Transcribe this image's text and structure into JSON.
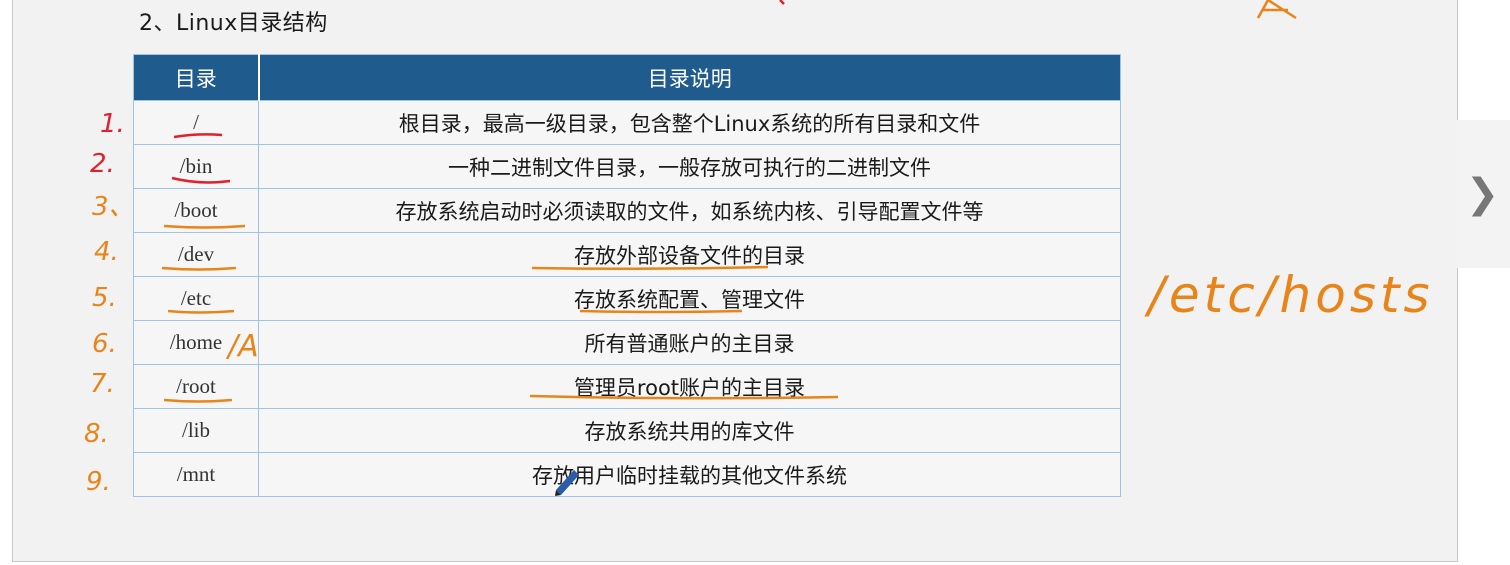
{
  "slide": {
    "title": "2、Linux目录结构"
  },
  "table": {
    "headers": [
      "目录",
      "目录说明"
    ],
    "rows": [
      {
        "dir": "/",
        "desc": "根目录，最高一级目录，包含整个Linux系统的所有目录和文件"
      },
      {
        "dir": "/bin",
        "desc": "一种二进制文件目录，一般存放可执行的二进制文件"
      },
      {
        "dir": "/boot",
        "desc": "存放系统启动时必须读取的文件，如系统内核、引导配置文件等"
      },
      {
        "dir": "/dev",
        "desc": "存放外部设备文件的目录"
      },
      {
        "dir": "/etc",
        "desc": "存放系统配置、管理文件"
      },
      {
        "dir": "/home",
        "desc": "所有普通账户的主目录"
      },
      {
        "dir": "/root",
        "desc": "管理员root账户的主目录"
      },
      {
        "dir": "/lib",
        "desc": "存放系统共用的库文件"
      },
      {
        "dir": "/mnt",
        "desc": "存放用户临时挂载的其他文件系统"
      }
    ]
  },
  "annotations": {
    "numbers": [
      "1.",
      "2.",
      "3、",
      "4.",
      "5.",
      "6.",
      "7.",
      "8.",
      "9."
    ],
    "home_note": "/A",
    "side_note": "/etc/hosts",
    "ink_color": "#e8851a",
    "red_ink_color": "#e0202a"
  },
  "nav": {
    "next_icon": "chevron-right-icon"
  }
}
